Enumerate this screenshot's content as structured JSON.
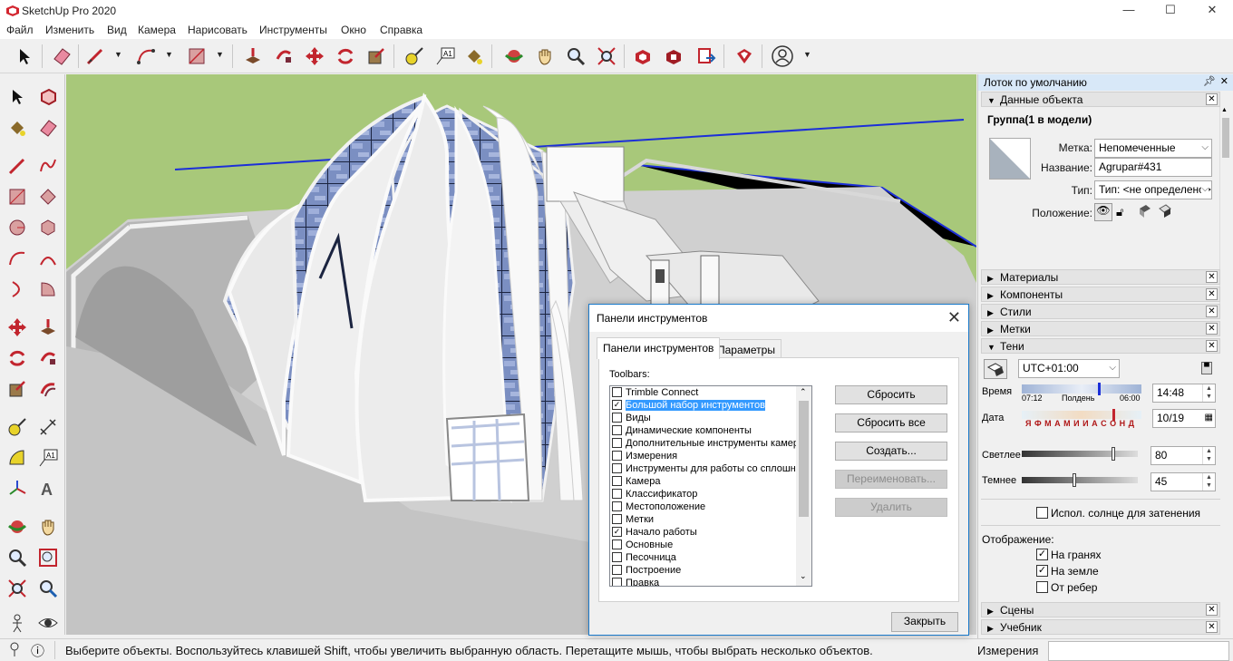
{
  "window": {
    "title": "SketchUp Pro 2020",
    "min": "—",
    "max": "☐",
    "close": "✕"
  },
  "menu": [
    "Файл",
    "Изменить",
    "Вид",
    "Камера",
    "Нарисовать",
    "Инструменты",
    "Окно",
    "Справка"
  ],
  "statusbar": {
    "info_icon": "ⓘ",
    "text": "Выберите объекты. Воспользуйтесь клавишей Shift, чтобы увеличить выбранную область. Перетащите мышь, чтобы выбрать несколько объектов.",
    "measure_label": "Измерения",
    "measure_value": ""
  },
  "tray": {
    "title": "Лоток по умолчанию",
    "entity_info": {
      "header": "Данные объекта",
      "object": "Группа(1 в модели)",
      "label_tag": "Метка:",
      "tag_value": "Непомеченные",
      "label_name": "Название:",
      "name_value": "Agrupar#431",
      "label_type": "Тип:",
      "type_value": "Тип: <не определено>",
      "label_position": "Положение:"
    },
    "sections": [
      "Материалы",
      "Компоненты",
      "Стили",
      "Метки"
    ],
    "shadows": {
      "header": "Тени",
      "timezone": "UTC+01:00",
      "time_label": "Время",
      "time_start": "07:12",
      "time_mid": "Полдень",
      "time_end": "06:00",
      "time_value": "14:48",
      "time_fraction": 0.66,
      "date_label": "Дата",
      "months": "Я Ф М А М И И А С О Н Д",
      "date_value": "10/19",
      "date_fraction": 0.78,
      "light_label": "Светлее",
      "light_value": "80",
      "dark_label": "Темнее",
      "dark_value": "45",
      "sun_label": "Испол. солнце для затенения",
      "sun_checked": false,
      "display_label": "Отображение:",
      "on_faces": "На гранях",
      "on_ground": "На земле",
      "from_edges": "От ребер",
      "on_faces_checked": true,
      "on_ground_checked": true,
      "from_edges_checked": false
    },
    "sections_bottom": [
      "Сцены",
      "Учебник"
    ]
  },
  "dialog": {
    "title": "Панели инструментов",
    "tab_toolbars": "Панели инструментов",
    "tab_options": "Параметры",
    "list_label": "Toolbars:",
    "items": [
      {
        "label": "Trimble Connect",
        "checked": false
      },
      {
        "label": "Большой набор инструментов",
        "checked": true,
        "selected": true
      },
      {
        "label": "Виды",
        "checked": false
      },
      {
        "label": "Динамические компоненты",
        "checked": false
      },
      {
        "label": "Дополнительные инструменты камер",
        "checked": false
      },
      {
        "label": "Измерения",
        "checked": false
      },
      {
        "label": "Инструменты для работы со сплошн",
        "checked": false
      },
      {
        "label": "Камера",
        "checked": false
      },
      {
        "label": "Классификатор",
        "checked": false
      },
      {
        "label": "Местоположение",
        "checked": false
      },
      {
        "label": "Метки",
        "checked": false
      },
      {
        "label": "Начало работы",
        "checked": true
      },
      {
        "label": "Основные",
        "checked": false
      },
      {
        "label": "Песочница",
        "checked": false
      },
      {
        "label": "Построение",
        "checked": false
      },
      {
        "label": "Правка",
        "checked": false
      }
    ],
    "btn_reset": "Сбросить",
    "btn_reset_all": "Сбросить все",
    "btn_create": "Создать...",
    "btn_rename": "Переименовать...",
    "btn_delete": "Удалить",
    "btn_close": "Закрыть"
  },
  "colors": {
    "accent": "#1979ca",
    "selection": "#3399ff",
    "grass": "#a8c87a",
    "sky_blue_line": "#1c2fd8"
  }
}
